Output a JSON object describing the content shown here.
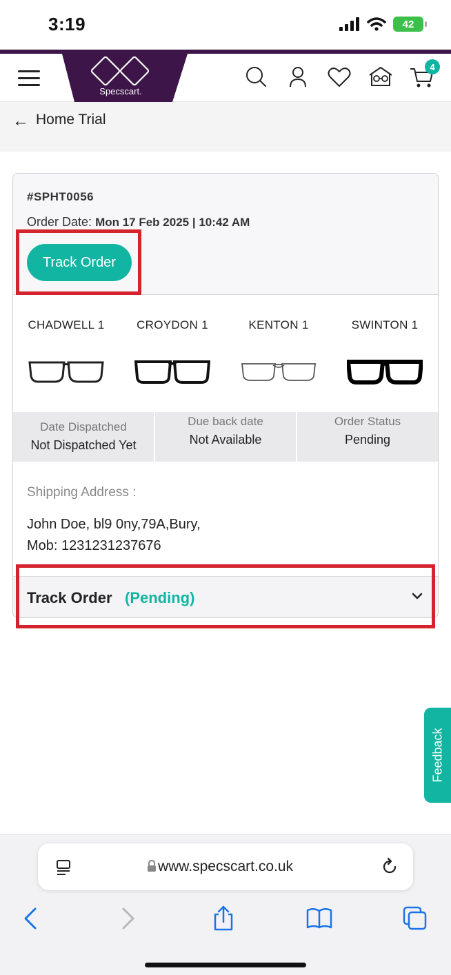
{
  "status_bar": {
    "time": "3:19",
    "battery": "42"
  },
  "header": {
    "logo_text": "Specscart.",
    "cart_count": "4"
  },
  "breadcrumb": {
    "title": "Home Trial"
  },
  "order": {
    "id": "#SPHT0056",
    "date_label": "Order Date:",
    "date_value": "Mon 17 Feb 2025 | 10:42 AM",
    "track_button": "Track Order",
    "products": [
      {
        "name": "CHADWELL 1"
      },
      {
        "name": "CROYDON 1"
      },
      {
        "name": "KENTON 1"
      },
      {
        "name": "SWINTON 1"
      }
    ],
    "status": [
      {
        "label": "Date Dispatched",
        "value": "Not Dispatched Yet"
      },
      {
        "label": "Due back date",
        "value": "Not Available"
      },
      {
        "label": "Order Status",
        "value": "Pending"
      }
    ],
    "shipping_label": "Shipping Address :",
    "shipping_line1": "John Doe, bl9 0ny,79A,Bury,",
    "shipping_line2": "Mob: 1231231237676",
    "track_bar_label": "Track Order",
    "track_bar_status": "(Pending)"
  },
  "feedback": "Feedback",
  "browser": {
    "url": "www.specscart.co.uk"
  },
  "colors": {
    "brand_purple": "#3d1548",
    "accent_teal": "#12b5a2",
    "highlight_red": "#d4232c"
  }
}
